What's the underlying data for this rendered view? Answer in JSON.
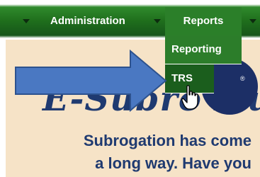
{
  "nav": {
    "items": [
      {
        "label": "Administration"
      },
      {
        "label": "Reports"
      }
    ]
  },
  "dropdown": {
    "items": [
      {
        "label": "Reporting"
      },
      {
        "label": "TRS"
      }
    ]
  },
  "banner": {
    "logo_text": "E-Subro Hub",
    "logo_registered": "®",
    "tagline_line1": "Subrogation has come",
    "tagline_line2": "a long way. Have you"
  },
  "colors": {
    "nav_green": "#1f6e1c",
    "nav_active": "#2b7f29",
    "banner_bg": "#f6e3c7",
    "brand_navy": "#1f3a70",
    "annotation_arrow": "#4a78c2"
  },
  "icons": {
    "nav_dropdown": "caret-down-icon",
    "annotation": "right-arrow-annotation",
    "cursor": "hand-pointer-icon"
  }
}
